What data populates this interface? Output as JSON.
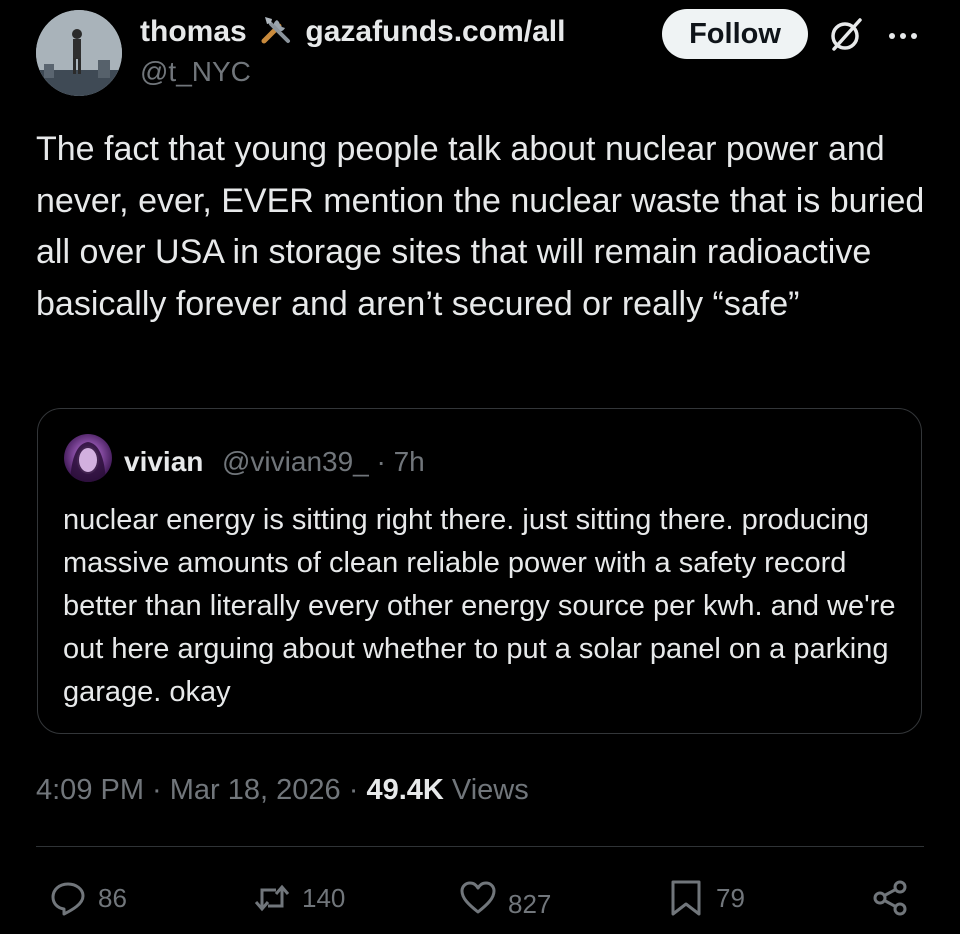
{
  "author": {
    "name": "thomas",
    "name_suffix": "gazafunds.com/all",
    "handle": "@t_NYC"
  },
  "follow_label": "Follow",
  "tweet_text": "The fact that young people talk about nuclear power and never, ever, EVER mention the nuclear waste that is buried all over USA in storage sites that will remain radioactive basically forever and aren’t secured or really “safe”",
  "quote": {
    "name": "vivian",
    "handle_time": "@vivian39_ · 7h",
    "text": "nuclear energy is sitting right there. just sitting there. producing massive amounts of clean reliable power with a safety record better than literally every other energy source per kwh. and we're out here arguing about whether to put a solar panel on a parking garage. okay"
  },
  "meta": {
    "time_date": "4:09 PM · Mar 18, 2026 · ",
    "views_count": "49.4K",
    "views_label": " Views"
  },
  "actions": {
    "replies": "86",
    "reposts": "140",
    "likes": "827",
    "bookmarks": "79"
  },
  "icons": [
    "tools-icon",
    "grok-icon",
    "more-icon",
    "reply-icon",
    "repost-icon",
    "like-icon",
    "bookmark-icon",
    "share-icon"
  ],
  "colors": {
    "background": "#000000",
    "text": "#e7e9ea",
    "secondary": "#71767b",
    "follow_bg": "#eff3f4",
    "border": "#333639"
  }
}
